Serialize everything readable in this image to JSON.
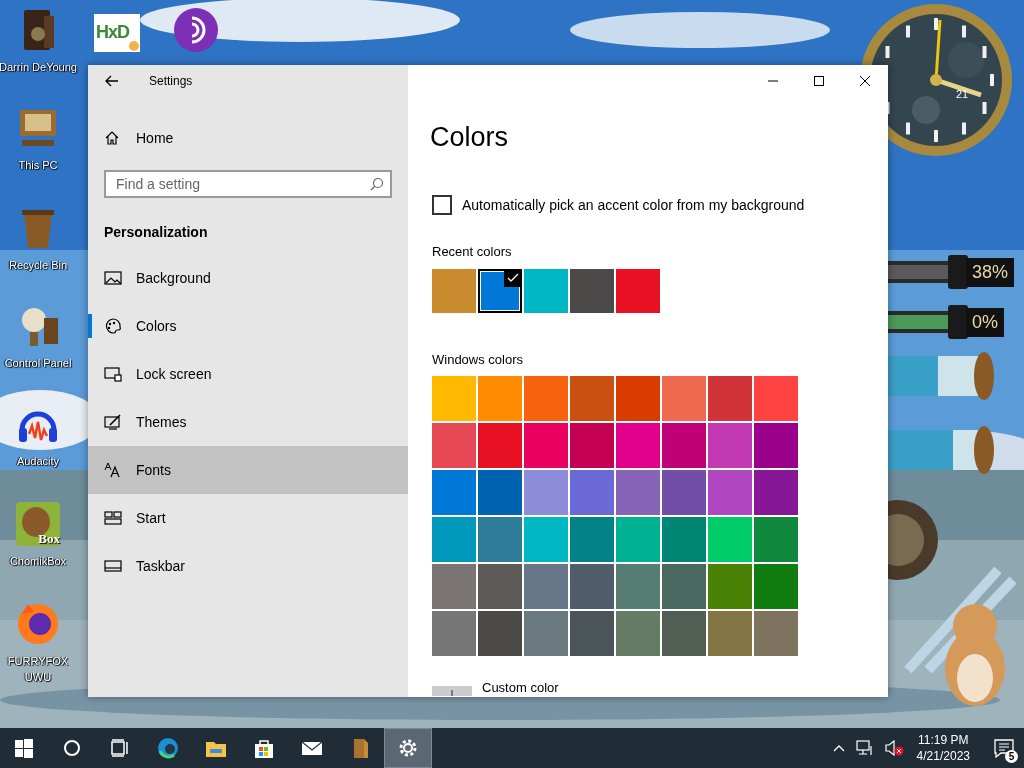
{
  "desktop": {
    "icons": [
      {
        "kind": "door",
        "label": "Darrin DeYoung"
      },
      {
        "kind": "hxd",
        "logo_text": "HxD"
      },
      {
        "kind": "onion"
      },
      {
        "kind": "computer",
        "label": "This PC"
      },
      {
        "kind": "bin",
        "label": "Recycle Bin"
      },
      {
        "kind": "lamp",
        "label": "Control Panel"
      },
      {
        "kind": "headphones",
        "label": "Audacity"
      },
      {
        "kind": "animal",
        "label": "ChomikBox",
        "logo_text": "Box"
      },
      {
        "kind": "fox",
        "label": "FURRYFOX UWU"
      }
    ],
    "gadgets": {
      "clock": {
        "date": "21"
      },
      "meters": [
        {
          "reading": "38%"
        },
        {
          "reading": "0%"
        }
      ]
    }
  },
  "window": {
    "title": "Settings",
    "home": "Home",
    "search": {
      "placeholder": "Find a setting"
    },
    "section": "Personalization",
    "nav": [
      {
        "kind": "background",
        "label": "Background",
        "selected": false,
        "hovered": false
      },
      {
        "kind": "colors",
        "label": "Colors",
        "selected": true,
        "hovered": false
      },
      {
        "kind": "lock",
        "label": "Lock screen",
        "selected": false,
        "hovered": false
      },
      {
        "kind": "themes",
        "label": "Themes",
        "selected": false,
        "hovered": false
      },
      {
        "kind": "fonts",
        "label": "Fonts",
        "selected": false,
        "hovered": true
      },
      {
        "kind": "start",
        "label": "Start",
        "selected": false,
        "hovered": false
      },
      {
        "kind": "taskbar",
        "label": "Taskbar",
        "selected": false,
        "hovered": false
      }
    ],
    "page_title": "Colors",
    "auto_pick": {
      "label": "Automatically pick an accent color from my background",
      "checked": false
    },
    "recent_colors": {
      "label": "Recent colors",
      "swatches": [
        {
          "color": "#ca8a2e",
          "selected": false
        },
        {
          "color": "#0078d7",
          "selected": true
        },
        {
          "color": "#00b7c3",
          "selected": false
        },
        {
          "color": "#4c4a48",
          "selected": false
        },
        {
          "color": "#e81123",
          "selected": false
        }
      ]
    },
    "windows_colors": {
      "label": "Windows colors",
      "swatches": [
        {
          "color": "#ffb900",
          "selected": false
        },
        {
          "color": "#ff8c00",
          "selected": false
        },
        {
          "color": "#f7630c",
          "selected": false
        },
        {
          "color": "#ca5010",
          "selected": false
        },
        {
          "color": "#da3b01",
          "selected": false
        },
        {
          "color": "#ef6950",
          "selected": false
        },
        {
          "color": "#d13438",
          "selected": false
        },
        {
          "color": "#ff4343",
          "selected": false
        },
        {
          "color": "#e74856",
          "selected": false
        },
        {
          "color": "#e81123",
          "selected": false
        },
        {
          "color": "#ea005e",
          "selected": false
        },
        {
          "color": "#c30052",
          "selected": false
        },
        {
          "color": "#e3008c",
          "selected": false
        },
        {
          "color": "#bf0077",
          "selected": false
        },
        {
          "color": "#c239b3",
          "selected": false
        },
        {
          "color": "#9a0089",
          "selected": false
        },
        {
          "color": "#0078d7",
          "selected": false
        },
        {
          "color": "#0063b1",
          "selected": false
        },
        {
          "color": "#8e8cd8",
          "selected": false
        },
        {
          "color": "#6b69d6",
          "selected": false
        },
        {
          "color": "#8764b8",
          "selected": false
        },
        {
          "color": "#744da9",
          "selected": false
        },
        {
          "color": "#b146c2",
          "selected": false
        },
        {
          "color": "#881798",
          "selected": false
        },
        {
          "color": "#0099bc",
          "selected": false
        },
        {
          "color": "#2d7d9a",
          "selected": false
        },
        {
          "color": "#00b7c3",
          "selected": false
        },
        {
          "color": "#038387",
          "selected": false
        },
        {
          "color": "#00b294",
          "selected": false
        },
        {
          "color": "#018574",
          "selected": false
        },
        {
          "color": "#00cc6a",
          "selected": false
        },
        {
          "color": "#10893e",
          "selected": false
        },
        {
          "color": "#7a7574",
          "selected": false
        },
        {
          "color": "#5d5a58",
          "selected": false
        },
        {
          "color": "#68768a",
          "selected": false
        },
        {
          "color": "#515c6b",
          "selected": false
        },
        {
          "color": "#567c73",
          "selected": false
        },
        {
          "color": "#486860",
          "selected": false
        },
        {
          "color": "#498205",
          "selected": false
        },
        {
          "color": "#107c10",
          "selected": false
        },
        {
          "color": "#767676",
          "selected": false
        },
        {
          "color": "#4c4a48",
          "selected": false
        },
        {
          "color": "#69797e",
          "selected": false
        },
        {
          "color": "#4a5459",
          "selected": false
        },
        {
          "color": "#647c64",
          "selected": false
        },
        {
          "color": "#525e54",
          "selected": false
        },
        {
          "color": "#847545",
          "selected": false
        },
        {
          "color": "#7e735f",
          "selected": false
        }
      ]
    },
    "custom_color": "Custom color"
  },
  "taskbar": {
    "apps": [
      {
        "kind": "start",
        "active": false
      },
      {
        "kind": "search",
        "active": false
      },
      {
        "kind": "taskview",
        "active": false
      },
      {
        "kind": "browser",
        "active": false
      },
      {
        "kind": "folder",
        "active": false
      },
      {
        "kind": "store",
        "active": false
      },
      {
        "kind": "mail",
        "active": false
      },
      {
        "kind": "document",
        "active": false
      },
      {
        "kind": "settings",
        "active": true
      }
    ],
    "tray": {
      "volume_muted": true,
      "time": "11:19 PM",
      "date": "4/21/2023",
      "notifications": "5"
    }
  }
}
